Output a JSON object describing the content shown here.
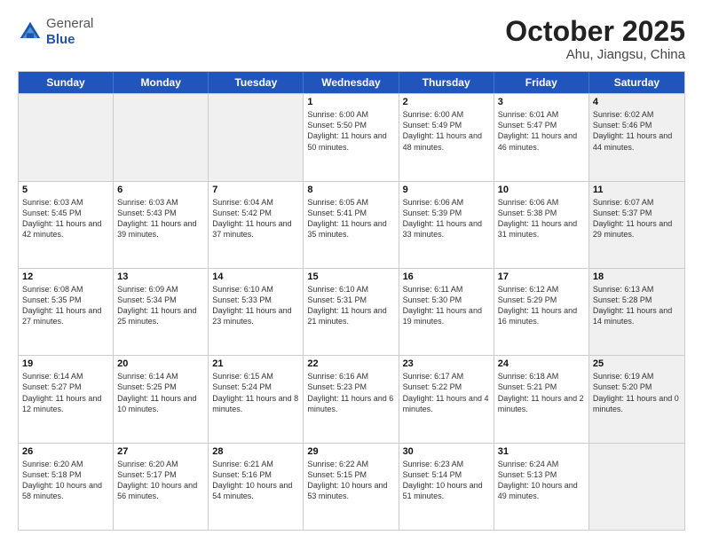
{
  "header": {
    "logo_line1": "General",
    "logo_line2": "Blue",
    "month_title": "October 2025",
    "location": "Ahu, Jiangsu, China"
  },
  "weekdays": [
    "Sunday",
    "Monday",
    "Tuesday",
    "Wednesday",
    "Thursday",
    "Friday",
    "Saturday"
  ],
  "rows": [
    [
      {
        "day": "",
        "info": "",
        "shaded": true
      },
      {
        "day": "",
        "info": "",
        "shaded": true
      },
      {
        "day": "",
        "info": "",
        "shaded": true
      },
      {
        "day": "1",
        "info": "Sunrise: 6:00 AM\nSunset: 5:50 PM\nDaylight: 11 hours\nand 50 minutes."
      },
      {
        "day": "2",
        "info": "Sunrise: 6:00 AM\nSunset: 5:49 PM\nDaylight: 11 hours\nand 48 minutes."
      },
      {
        "day": "3",
        "info": "Sunrise: 6:01 AM\nSunset: 5:47 PM\nDaylight: 11 hours\nand 46 minutes."
      },
      {
        "day": "4",
        "info": "Sunrise: 6:02 AM\nSunset: 5:46 PM\nDaylight: 11 hours\nand 44 minutes.",
        "shaded": true
      }
    ],
    [
      {
        "day": "5",
        "info": "Sunrise: 6:03 AM\nSunset: 5:45 PM\nDaylight: 11 hours\nand 42 minutes."
      },
      {
        "day": "6",
        "info": "Sunrise: 6:03 AM\nSunset: 5:43 PM\nDaylight: 11 hours\nand 39 minutes."
      },
      {
        "day": "7",
        "info": "Sunrise: 6:04 AM\nSunset: 5:42 PM\nDaylight: 11 hours\nand 37 minutes."
      },
      {
        "day": "8",
        "info": "Sunrise: 6:05 AM\nSunset: 5:41 PM\nDaylight: 11 hours\nand 35 minutes."
      },
      {
        "day": "9",
        "info": "Sunrise: 6:06 AM\nSunset: 5:39 PM\nDaylight: 11 hours\nand 33 minutes."
      },
      {
        "day": "10",
        "info": "Sunrise: 6:06 AM\nSunset: 5:38 PM\nDaylight: 11 hours\nand 31 minutes."
      },
      {
        "day": "11",
        "info": "Sunrise: 6:07 AM\nSunset: 5:37 PM\nDaylight: 11 hours\nand 29 minutes.",
        "shaded": true
      }
    ],
    [
      {
        "day": "12",
        "info": "Sunrise: 6:08 AM\nSunset: 5:35 PM\nDaylight: 11 hours\nand 27 minutes."
      },
      {
        "day": "13",
        "info": "Sunrise: 6:09 AM\nSunset: 5:34 PM\nDaylight: 11 hours\nand 25 minutes."
      },
      {
        "day": "14",
        "info": "Sunrise: 6:10 AM\nSunset: 5:33 PM\nDaylight: 11 hours\nand 23 minutes."
      },
      {
        "day": "15",
        "info": "Sunrise: 6:10 AM\nSunset: 5:31 PM\nDaylight: 11 hours\nand 21 minutes."
      },
      {
        "day": "16",
        "info": "Sunrise: 6:11 AM\nSunset: 5:30 PM\nDaylight: 11 hours\nand 19 minutes."
      },
      {
        "day": "17",
        "info": "Sunrise: 6:12 AM\nSunset: 5:29 PM\nDaylight: 11 hours\nand 16 minutes."
      },
      {
        "day": "18",
        "info": "Sunrise: 6:13 AM\nSunset: 5:28 PM\nDaylight: 11 hours\nand 14 minutes.",
        "shaded": true
      }
    ],
    [
      {
        "day": "19",
        "info": "Sunrise: 6:14 AM\nSunset: 5:27 PM\nDaylight: 11 hours\nand 12 minutes."
      },
      {
        "day": "20",
        "info": "Sunrise: 6:14 AM\nSunset: 5:25 PM\nDaylight: 11 hours\nand 10 minutes."
      },
      {
        "day": "21",
        "info": "Sunrise: 6:15 AM\nSunset: 5:24 PM\nDaylight: 11 hours\nand 8 minutes."
      },
      {
        "day": "22",
        "info": "Sunrise: 6:16 AM\nSunset: 5:23 PM\nDaylight: 11 hours\nand 6 minutes."
      },
      {
        "day": "23",
        "info": "Sunrise: 6:17 AM\nSunset: 5:22 PM\nDaylight: 11 hours\nand 4 minutes."
      },
      {
        "day": "24",
        "info": "Sunrise: 6:18 AM\nSunset: 5:21 PM\nDaylight: 11 hours\nand 2 minutes."
      },
      {
        "day": "25",
        "info": "Sunrise: 6:19 AM\nSunset: 5:20 PM\nDaylight: 11 hours\nand 0 minutes.",
        "shaded": true
      }
    ],
    [
      {
        "day": "26",
        "info": "Sunrise: 6:20 AM\nSunset: 5:18 PM\nDaylight: 10 hours\nand 58 minutes."
      },
      {
        "day": "27",
        "info": "Sunrise: 6:20 AM\nSunset: 5:17 PM\nDaylight: 10 hours\nand 56 minutes."
      },
      {
        "day": "28",
        "info": "Sunrise: 6:21 AM\nSunset: 5:16 PM\nDaylight: 10 hours\nand 54 minutes."
      },
      {
        "day": "29",
        "info": "Sunrise: 6:22 AM\nSunset: 5:15 PM\nDaylight: 10 hours\nand 53 minutes."
      },
      {
        "day": "30",
        "info": "Sunrise: 6:23 AM\nSunset: 5:14 PM\nDaylight: 10 hours\nand 51 minutes."
      },
      {
        "day": "31",
        "info": "Sunrise: 6:24 AM\nSunset: 5:13 PM\nDaylight: 10 hours\nand 49 minutes."
      },
      {
        "day": "",
        "info": "",
        "shaded": true
      }
    ]
  ]
}
